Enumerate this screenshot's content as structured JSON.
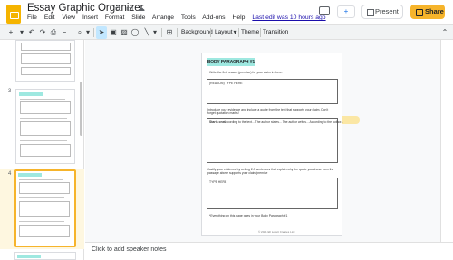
{
  "app": {
    "title": "Essay Graphic Organizer",
    "star_icon": "star-icon",
    "move_icon": "folder-icon",
    "cloud_icon": "cloud-icon"
  },
  "menu": {
    "items": [
      "File",
      "Edit",
      "View",
      "Insert",
      "Format",
      "Slide",
      "Arrange",
      "Tools",
      "Add-ons",
      "Help"
    ],
    "last_edit": "Last edit was 10 hours ago"
  },
  "header": {
    "present_label": "Present",
    "share_label": "Share",
    "meet_label": "+"
  },
  "toolbar": {
    "background_label": "Background",
    "layout_label": "Layout",
    "theme_label": "Theme",
    "transition_label": "Transition"
  },
  "filmstrip": {
    "slide_numbers": [
      "3",
      "4"
    ]
  },
  "slide": {
    "banner": "BODY PARAGRAPH #1",
    "instruction1": "Write the first reason (premise) for your claim in there.",
    "box1_label": "(REASON) TYPE HERE",
    "instruction2a": "Introduce your evidence and include a quote from the text that supports your claim. Don't",
    "instruction2b": "forget quotation marks!",
    "box2_label": "Starts one:",
    "box2_hints": "According to the text...    The author states...    The author writes...    According to the author...",
    "instruction3a": "Justify your evidence by writing 2-3 sentences that explain why the quote you chose from the",
    "instruction3b": "passage above supports your claim/premise",
    "box3_label": "TYPE HERE",
    "footer_note": "*Everything on this page goes in your Body Paragraph #1",
    "credit": "© 2021 Ell Lovett Creates LLC"
  },
  "notes": {
    "placeholder": "Click to add speaker notes"
  },
  "colors": {
    "accent": "#f6b42b",
    "banner": "#9ee8e0",
    "highlight": "#fbe7a4",
    "link": "#1a0dab"
  }
}
